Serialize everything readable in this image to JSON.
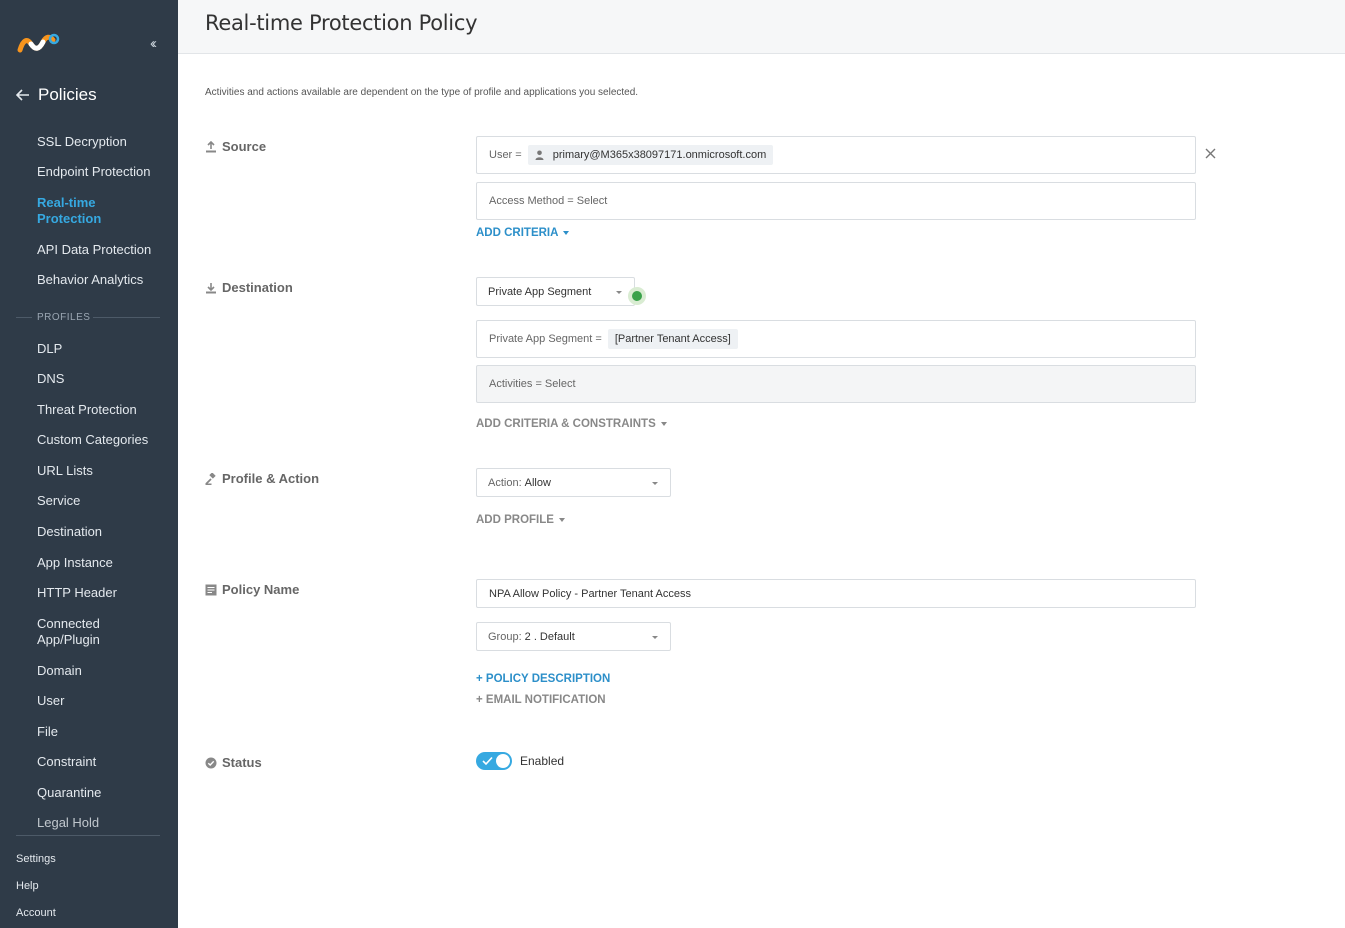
{
  "sidebar": {
    "back_title": "Policies",
    "items": [
      {
        "label": "SSL Decryption"
      },
      {
        "label": "Endpoint Protection"
      },
      {
        "label": "Real-time Protection"
      },
      {
        "label": "API Data Protection"
      },
      {
        "label": "Behavior Analytics"
      }
    ],
    "profiles_label": "PROFILES",
    "profiles": [
      {
        "label": "DLP"
      },
      {
        "label": "DNS"
      },
      {
        "label": "Threat Protection"
      },
      {
        "label": "Custom Categories"
      },
      {
        "label": "URL Lists"
      },
      {
        "label": "Service"
      },
      {
        "label": "Destination"
      },
      {
        "label": "App Instance"
      },
      {
        "label": "HTTP Header"
      },
      {
        "label": "Connected App/Plugin"
      },
      {
        "label": "Domain"
      },
      {
        "label": "User"
      },
      {
        "label": "File"
      },
      {
        "label": "Constraint"
      },
      {
        "label": "Quarantine"
      },
      {
        "label": "Legal Hold"
      }
    ],
    "bottom": [
      {
        "label": "Settings"
      },
      {
        "label": "Help"
      },
      {
        "label": "Account"
      }
    ],
    "active_color": "#36a9e1"
  },
  "header": {
    "title": "Real-time Protection Policy"
  },
  "note": "Activities and actions available are dependent on the type of profile and applications you selected.",
  "source": {
    "label": "Source",
    "user_prefix": "User =",
    "user_value": "primary@M365x38097171.onmicrosoft.com",
    "access_method": "Access Method = Select",
    "add_criteria": "ADD CRITERIA"
  },
  "destination": {
    "label": "Destination",
    "type_select": "Private App Segment",
    "segment_prefix": "Private App Segment =",
    "segment_value": "[Partner Tenant Access]",
    "activities": "Activities = Select",
    "add_constraints": "ADD CRITERIA & CONSTRAINTS"
  },
  "profile_action": {
    "label": "Profile & Action",
    "action_label": "Action:",
    "action_value": "Allow",
    "add_profile": "ADD PROFILE"
  },
  "policy_name": {
    "label": "Policy Name",
    "value": "NPA Allow Policy - Partner Tenant Access",
    "group_label": "Group:",
    "group_value": "2 . Default",
    "policy_description": "+ POLICY DESCRIPTION",
    "email_notification": "+ EMAIL NOTIFICATION"
  },
  "status": {
    "label": "Status",
    "toggle_label": "Enabled",
    "enabled": true
  }
}
